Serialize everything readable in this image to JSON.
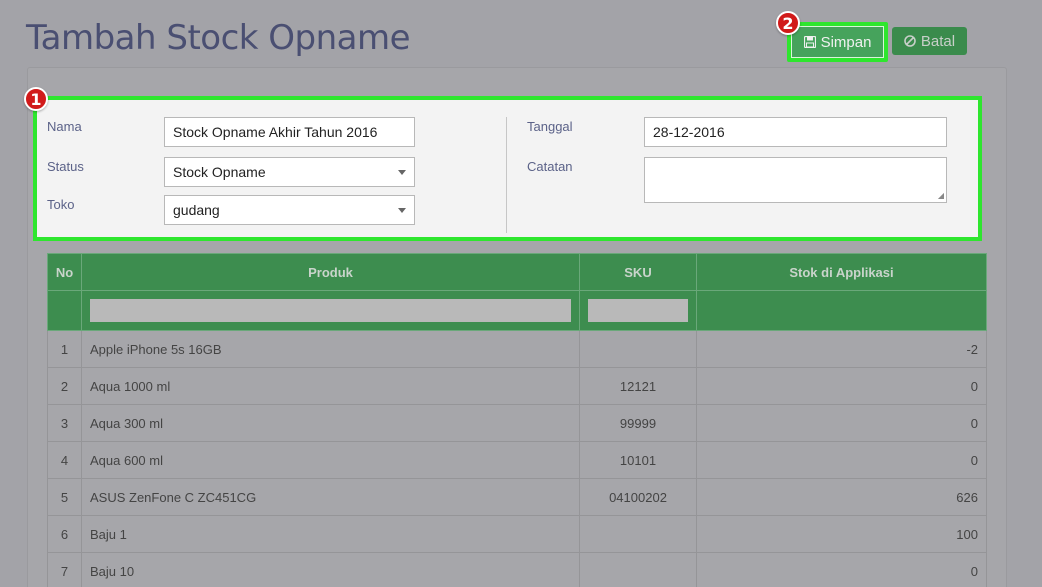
{
  "page_title": "Tambah Stock Opname",
  "buttons": {
    "simpan": "Simpan",
    "batal": "Batal"
  },
  "badges": [
    "1",
    "2"
  ],
  "form": {
    "nama_label": "Nama",
    "nama_value": "Stock Opname Akhir Tahun 2016",
    "status_label": "Status",
    "status_value": "Stock Opname",
    "toko_label": "Toko",
    "toko_value": "gudang",
    "tanggal_label": "Tanggal",
    "tanggal_value": "28-12-2016",
    "catatan_label": "Catatan",
    "catatan_value": ""
  },
  "table": {
    "headers": [
      "No",
      "Produk",
      "SKU",
      "Stok di Applikasi"
    ],
    "rows": [
      {
        "no": "1",
        "produk": "Apple iPhone 5s 16GB",
        "sku": "",
        "stok": "-2"
      },
      {
        "no": "2",
        "produk": "Aqua 1000 ml",
        "sku": "12121",
        "stok": "0"
      },
      {
        "no": "3",
        "produk": "Aqua 300 ml",
        "sku": "99999",
        "stok": "0"
      },
      {
        "no": "4",
        "produk": "Aqua 600 ml",
        "sku": "10101",
        "stok": "0"
      },
      {
        "no": "5",
        "produk": "ASUS ZenFone C ZC451CG",
        "sku": "04100202",
        "stok": "626"
      },
      {
        "no": "6",
        "produk": "Baju 1",
        "sku": "",
        "stok": "100"
      },
      {
        "no": "7",
        "produk": "Baju 10",
        "sku": "",
        "stok": "0"
      }
    ]
  },
  "colors": {
    "header_green": "#3d8d4f",
    "highlight": "#2ee62e",
    "badge_red": "#d11a1a",
    "title": "#4a4f72"
  }
}
